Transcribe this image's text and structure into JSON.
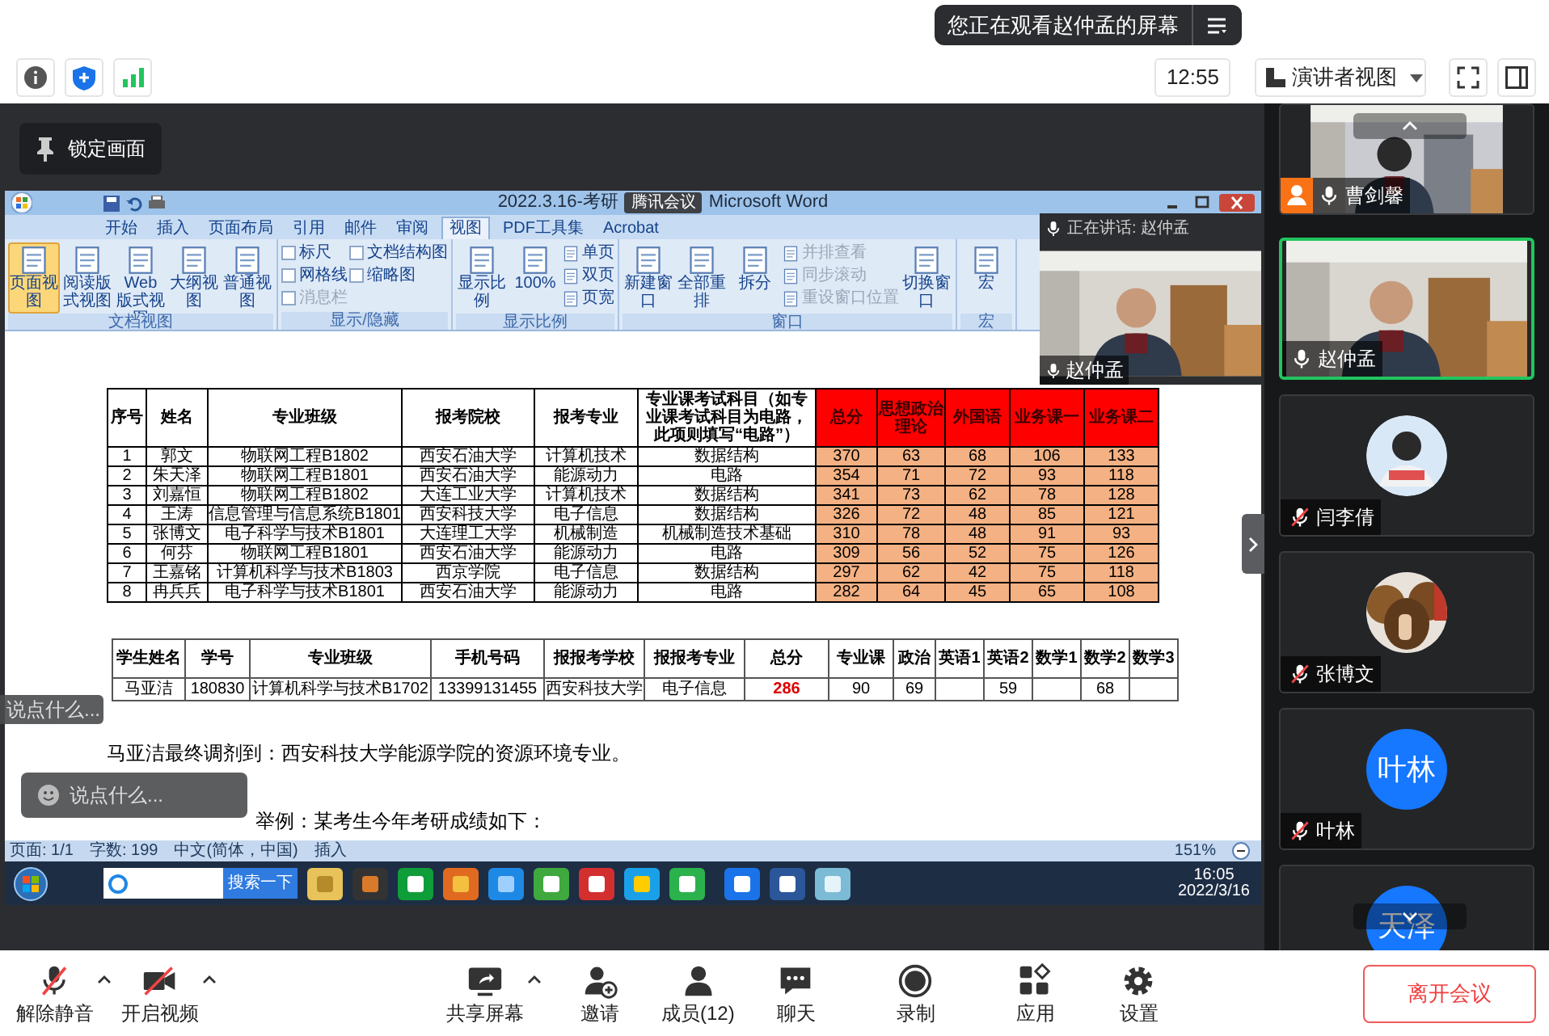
{
  "notice": {
    "text": "您正在观看赵仲孟的屏幕"
  },
  "toolbar": {
    "time": "12:55",
    "view_mode": "演讲者视图"
  },
  "lock_button": {
    "label": "锁定画面"
  },
  "shared_screen": {
    "title": "2022.3.16-考研",
    "title_suffix": "Microsoft Word",
    "meeting_badge": "腾讯会议",
    "tabs": [
      {
        "label": "开始",
        "selected": false
      },
      {
        "label": "插入",
        "selected": false
      },
      {
        "label": "页面布局",
        "selected": false
      },
      {
        "label": "引用",
        "selected": false
      },
      {
        "label": "邮件",
        "selected": false
      },
      {
        "label": "审阅",
        "selected": false
      },
      {
        "label": "视图",
        "selected": true
      },
      {
        "label": "PDF工具集",
        "selected": false
      },
      {
        "label": "Acrobat",
        "selected": false
      }
    ],
    "ribbon_groups": [
      {
        "label": "文档视图",
        "items": [
          {
            "kind": "big",
            "label": "页面视图",
            "selected": true
          },
          {
            "kind": "big",
            "label": "阅读版式视图",
            "selected": false
          },
          {
            "kind": "big",
            "label": "Web 版式视图",
            "selected": false
          },
          {
            "kind": "big",
            "label": "大纲视图",
            "selected": false
          },
          {
            "kind": "big",
            "label": "普通视图",
            "selected": false
          }
        ]
      },
      {
        "label": "显示/隐藏",
        "items": [
          {
            "kind": "check",
            "label": "标尺",
            "checked": false,
            "disabled": false
          },
          {
            "kind": "check",
            "label": "网格线",
            "checked": false,
            "disabled": false
          },
          {
            "kind": "check",
            "label": "消息栏",
            "checked": false,
            "disabled": true
          },
          {
            "kind": "check",
            "label": "文档结构图",
            "checked": false,
            "disabled": false
          },
          {
            "kind": "check",
            "label": "缩略图",
            "checked": false,
            "disabled": false
          }
        ]
      },
      {
        "label": "显示比例",
        "items": [
          {
            "kind": "big",
            "label": "显示比例",
            "selected": false
          },
          {
            "kind": "big",
            "label": "100%",
            "selected": false
          },
          {
            "kind": "small",
            "label": "单页",
            "disabled": false
          },
          {
            "kind": "small",
            "label": "双页",
            "disabled": false
          },
          {
            "kind": "small",
            "label": "页宽",
            "disabled": false
          }
        ]
      },
      {
        "label": "窗口",
        "items": [
          {
            "kind": "big",
            "label": "新建窗口",
            "selected": false
          },
          {
            "kind": "big",
            "label": "全部重排",
            "selected": false
          },
          {
            "kind": "big",
            "label": "拆分",
            "selected": false
          },
          {
            "kind": "small",
            "label": "并排查看",
            "disabled": true
          },
          {
            "kind": "small",
            "label": "同步滚动",
            "disabled": true
          },
          {
            "kind": "small",
            "label": "重设窗口位置",
            "disabled": true
          },
          {
            "kind": "big",
            "label": "切换窗口",
            "selected": false
          }
        ]
      },
      {
        "label": "宏",
        "items": [
          {
            "kind": "big",
            "label": "宏",
            "selected": false
          }
        ]
      }
    ],
    "speaker": {
      "header": "正在讲话: 赵仲孟",
      "name": "赵仲孟"
    },
    "table_1": {
      "columns": [
        {
          "label": "序号",
          "kind": "info"
        },
        {
          "label": "姓名",
          "kind": "info"
        },
        {
          "label": "专业班级",
          "kind": "info"
        },
        {
          "label": "报考院校",
          "kind": "info"
        },
        {
          "label": "报考专业",
          "kind": "info"
        },
        {
          "label": "专业课考试科目（如专业课考试科目为电路，此项则填写“电路”）",
          "kind": "info"
        },
        {
          "label": "总分",
          "kind": "score"
        },
        {
          "label": "思想政治理论",
          "kind": "score"
        },
        {
          "label": "外国语",
          "kind": "score"
        },
        {
          "label": "业务课一",
          "kind": "score"
        },
        {
          "label": "业务课二",
          "kind": "score"
        }
      ],
      "rows": [
        [
          "1",
          "郭文",
          "物联网工程B1802",
          "西安石油大学",
          "计算机技术",
          "数据结构",
          "370",
          "63",
          "68",
          "106",
          "133"
        ],
        [
          "2",
          "朱天泽",
          "物联网工程B1801",
          "西安石油大学",
          "能源动力",
          "电路",
          "354",
          "71",
          "72",
          "93",
          "118"
        ],
        [
          "3",
          "刘嘉恒",
          "物联网工程B1802",
          "大连工业大学",
          "计算机技术",
          "数据结构",
          "341",
          "73",
          "62",
          "78",
          "128"
        ],
        [
          "4",
          "王涛",
          "信息管理与信息系统B1801",
          "西安科技大学",
          "电子信息",
          "数据结构",
          "326",
          "72",
          "48",
          "85",
          "121"
        ],
        [
          "5",
          "张博文",
          "电子科学与技术B1801",
          "大连理工大学",
          "机械制造",
          "机械制造技术基础",
          "310",
          "78",
          "48",
          "91",
          "93"
        ],
        [
          "6",
          "何芬",
          "物联网工程B1801",
          "西安石油大学",
          "能源动力",
          "电路",
          "309",
          "56",
          "52",
          "75",
          "126"
        ],
        [
          "7",
          "王嘉铭",
          "计算机科学与技术B1803",
          "西京学院",
          "电子信息",
          "数据结构",
          "297",
          "62",
          "42",
          "75",
          "118"
        ],
        [
          "8",
          "冉兵兵",
          "电子科学与技术B1801",
          "西安石油大学",
          "能源动力",
          "电路",
          "282",
          "64",
          "45",
          "65",
          "108"
        ]
      ]
    },
    "table_2": {
      "columns": [
        {
          "label": "学生姓名",
          "kind": "plain"
        },
        {
          "label": "学号",
          "kind": "plain"
        },
        {
          "label": "专业班级",
          "kind": "plain"
        },
        {
          "label": "手机号码",
          "kind": "plain"
        },
        {
          "label": "报报考学校",
          "kind": "plain"
        },
        {
          "label": "报报考专业",
          "kind": "plain"
        },
        {
          "label": "总分",
          "kind": "highlight"
        },
        {
          "label": "专业课",
          "kind": "plain"
        },
        {
          "label": "政治",
          "kind": "plain"
        },
        {
          "label": "英语1",
          "kind": "plain"
        },
        {
          "label": "英语2",
          "kind": "plain"
        },
        {
          "label": "数学1",
          "kind": "plain"
        },
        {
          "label": "数学2",
          "kind": "plain"
        },
        {
          "label": "数学3",
          "kind": "plain"
        }
      ],
      "rows": [
        [
          "马亚洁",
          "180830",
          "计算机科学与技术B1702",
          "13399131455",
          "西安科技大学",
          "电子信息",
          "286",
          "90",
          "69",
          "",
          "59",
          "",
          "68",
          ""
        ]
      ]
    },
    "paragraphs": [
      "马亚洁最终调剂到：西安科技大学能源学院的资源环境专业。",
      "举例：某考生今年考研成绩如下："
    ],
    "status_bar": {
      "items": [
        "页面: 1/1",
        "字数: 199",
        "中文(简体，中国)",
        "插入"
      ],
      "zoom": "151%"
    },
    "taskbar": {
      "search_button": "搜索一下",
      "time": "16:05",
      "date": "2022/3/16"
    }
  },
  "chat_inputs": [
    {
      "kind": "compact",
      "placeholder": "说点什么..."
    },
    {
      "kind": "full",
      "placeholder": "说点什么..."
    }
  ],
  "participants": [
    {
      "kind": "video",
      "name": "曹剑馨",
      "muted": false,
      "speaking": false,
      "host": true
    },
    {
      "kind": "video",
      "name": "赵仲孟",
      "muted": false,
      "speaking": true,
      "host": false
    },
    {
      "kind": "avatar",
      "name": "闫李倩",
      "muted": true,
      "speaking": false,
      "host": false
    },
    {
      "name": "张博文",
      "muted": true,
      "speaking": false,
      "host": false
    },
    {
      "kind": "initials",
      "initials": "叶林",
      "name": "叶林",
      "muted": true,
      "speaking": false,
      "host": false
    },
    {
      "kind": "initials",
      "initials": "天泽",
      "speaking": false
    }
  ],
  "controls": [
    {
      "kind": "mic-off",
      "label": "解除静音",
      "caret": true
    },
    {
      "kind": "video-off",
      "label": "开启视频",
      "caret": true
    },
    {
      "kind": "share",
      "label": "共享屏幕",
      "caret": true
    },
    {
      "kind": "invite",
      "label": "邀请",
      "caret": false
    },
    {
      "kind": "members",
      "label": "成员(12)",
      "caret": false
    },
    {
      "kind": "chat",
      "label": "聊天",
      "caret": false
    },
    {
      "kind": "record",
      "label": "录制",
      "caret": false
    },
    {
      "kind": "apps",
      "label": "应用",
      "caret": false
    },
    {
      "kind": "settings",
      "label": "设置",
      "caret": false
    }
  ],
  "leave_button": {
    "label": "离开会议"
  }
}
